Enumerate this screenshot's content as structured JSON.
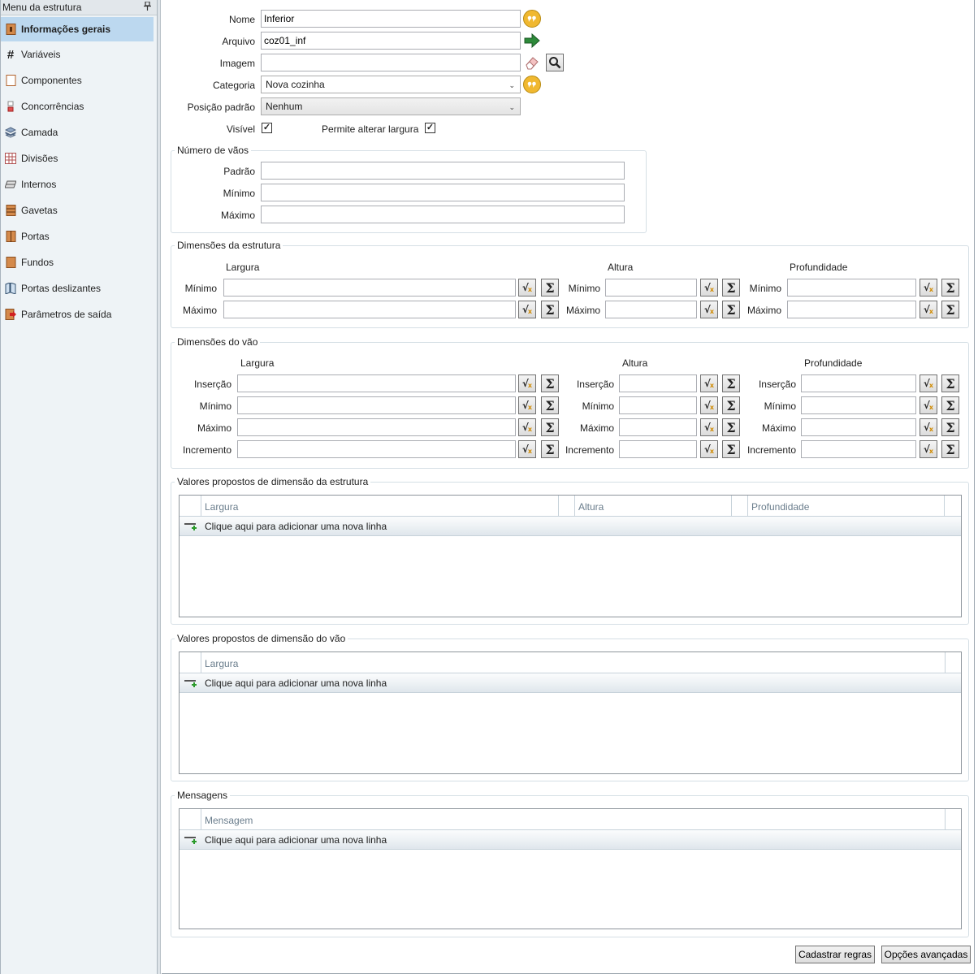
{
  "sidebar": {
    "title": "Menu da estrutura",
    "pin_icon": "pin-icon",
    "items": [
      {
        "label": "Informações gerais",
        "icon": "info-icon",
        "active": true
      },
      {
        "label": "Variáveis",
        "icon": "hash-icon"
      },
      {
        "label": "Componentes",
        "icon": "component-icon"
      },
      {
        "label": "Concorrências",
        "icon": "concurrency-icon"
      },
      {
        "label": "Camada",
        "icon": "layer-icon"
      },
      {
        "label": "Divisões",
        "icon": "grid-icon"
      },
      {
        "label": "Internos",
        "icon": "internal-icon"
      },
      {
        "label": "Gavetas",
        "icon": "drawer-icon"
      },
      {
        "label": "Portas",
        "icon": "door-icon"
      },
      {
        "label": "Fundos",
        "icon": "back-panel-icon"
      },
      {
        "label": "Portas deslizantes",
        "icon": "sliding-door-icon"
      },
      {
        "label": "Parâmetros de saída",
        "icon": "output-params-icon"
      }
    ]
  },
  "general": {
    "nome_label": "Nome",
    "nome_value": "Inferior",
    "arquivo_label": "Arquivo",
    "arquivo_value": "coz01_inf",
    "imagem_label": "Imagem",
    "imagem_value": "",
    "categoria_label": "Categoria",
    "categoria_value": "Nova cozinha",
    "posicao_label": "Posição padrão",
    "posicao_value": "Nenhum",
    "visivel_label": "Visível",
    "visivel_checked": true,
    "permite_label": "Permite alterar largura",
    "permite_checked": true,
    "check_mark": "✓"
  },
  "vaos": {
    "title": "Número de vãos",
    "padrao_label": "Padrão",
    "minimo_label": "Mínimo",
    "maximo_label": "Máximo",
    "padrao_value": "",
    "minimo_value": "",
    "maximo_value": ""
  },
  "dim_estrutura": {
    "title": "Dimensões da estrutura",
    "col_largura": "Largura",
    "col_altura": "Altura",
    "col_profundidade": "Profundidade",
    "minimo_label": "Mínimo",
    "maximo_label": "Máximo"
  },
  "dim_vao": {
    "title": "Dimensões do vão",
    "col_largura": "Largura",
    "col_altura": "Altura",
    "col_profundidade": "Profundidade",
    "insercao_label": "Inserção",
    "minimo_label": "Mínimo",
    "maximo_label": "Máximo",
    "incremento_label": "Incremento"
  },
  "icons": {
    "sqrt": "√",
    "sqrt_x": "x",
    "sigma": "Σ"
  },
  "valores_estrutura": {
    "title": "Valores propostos de dimensão da estrutura",
    "columns": [
      "Largura",
      "Altura",
      "Profundidade"
    ],
    "new_row": "Clique aqui para adicionar uma nova linha"
  },
  "valores_vao": {
    "title": "Valores propostos de dimensão do vão",
    "columns": [
      "Largura"
    ],
    "new_row": "Clique aqui para adicionar uma nova linha"
  },
  "mensagens": {
    "title": "Mensagens",
    "columns": [
      "Mensagem"
    ],
    "new_row": "Clique aqui para adicionar uma nova linha"
  },
  "footer": {
    "cadastrar": "Cadastrar regras",
    "opcoes": "Opções avançadas"
  }
}
